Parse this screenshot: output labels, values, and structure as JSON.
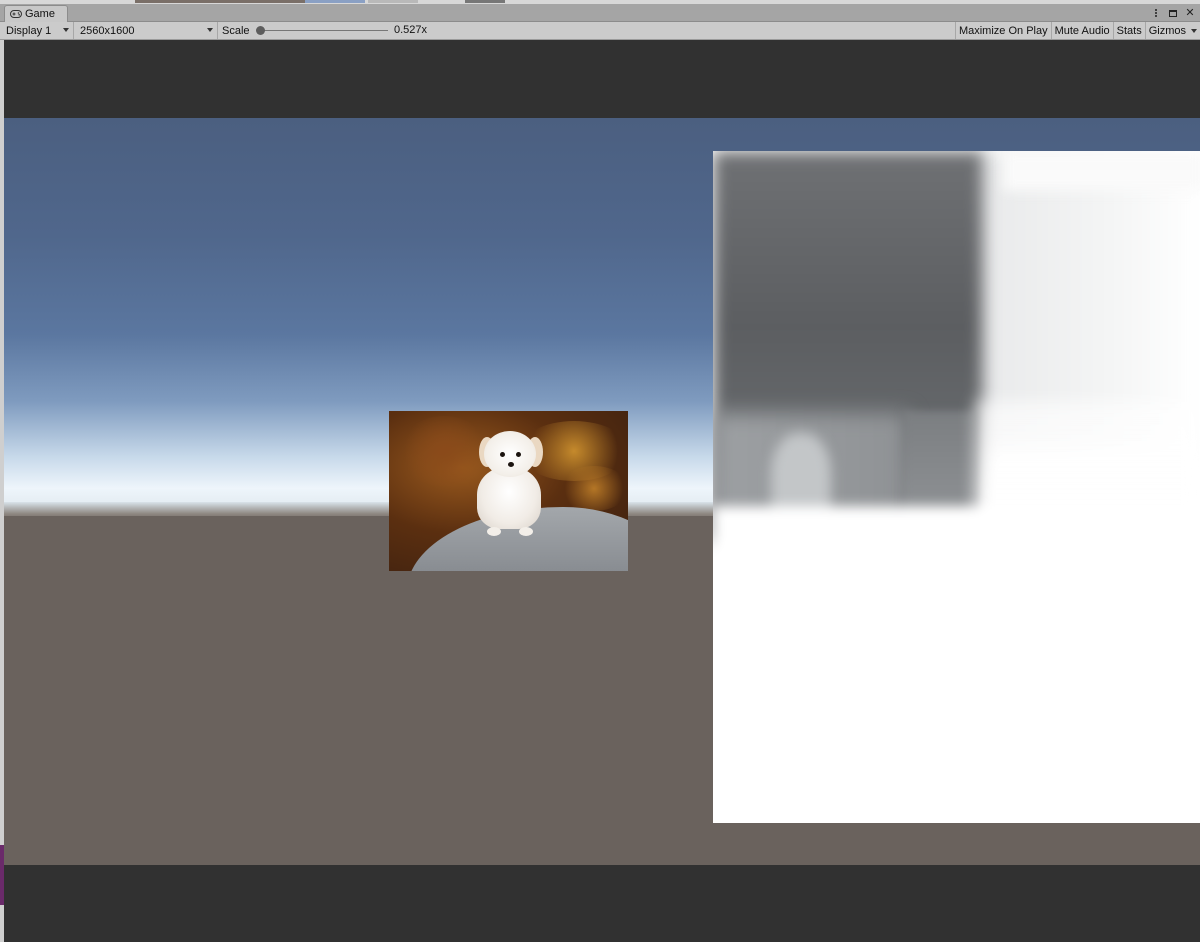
{
  "window": {
    "tab_label": "Game",
    "tab_icon": "gamepad-icon",
    "controls": {
      "menu_icon": "vertical-dots-icon",
      "maximize_icon": "maximize-icon",
      "close_glyph": "✕"
    }
  },
  "toolbar": {
    "display": "Display 1",
    "resolution": "2560x1600",
    "scale_label": "Scale",
    "scale_value": "0.527x",
    "scale_fraction": 0.0,
    "maximize_on_play": "Maximize On Play",
    "mute_audio": "Mute Audio",
    "stats": "Stats",
    "gizmos": "Gizmos"
  },
  "scene": {
    "sky_top_color": "#4b5f80",
    "horizon_color": "#eef5fb",
    "ground_color": "#6a625d",
    "letterbox_color": "#313131",
    "objects": [
      "dog-photo-quad",
      "depth-map-quad"
    ]
  }
}
